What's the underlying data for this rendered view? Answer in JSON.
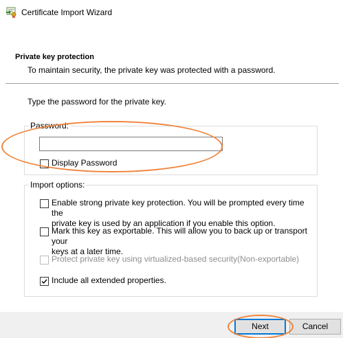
{
  "window": {
    "title": "Certificate Import Wizard",
    "icon": "certificate-icon"
  },
  "header": {
    "heading": "Private key protection",
    "subheading": "To maintain security, the private key was protected with a password."
  },
  "instruction": "Type the password for the private key.",
  "password_group": {
    "legend": "Password:",
    "input_value": "",
    "display_password_label": "Display Password",
    "display_password_checked": false
  },
  "import_options": {
    "legend": "Import options:",
    "options": [
      {
        "line1": "Enable strong private key protection. You will be prompted every time the",
        "line2": "private key is used by an application if you enable this option.",
        "checked": false,
        "enabled": true
      },
      {
        "line1": "Mark this key as exportable. This will allow you to back up or transport your",
        "line2": "keys at a later time.",
        "checked": false,
        "enabled": true
      },
      {
        "line1": "Protect private key using virtualized-based security(Non-exportable)",
        "checked": false,
        "enabled": false
      },
      {
        "line1": "Include all extended properties.",
        "checked": true,
        "enabled": true
      }
    ]
  },
  "buttons": {
    "next_label": "Next",
    "cancel_label": "Cancel"
  },
  "annotation_color": "#f0843a"
}
